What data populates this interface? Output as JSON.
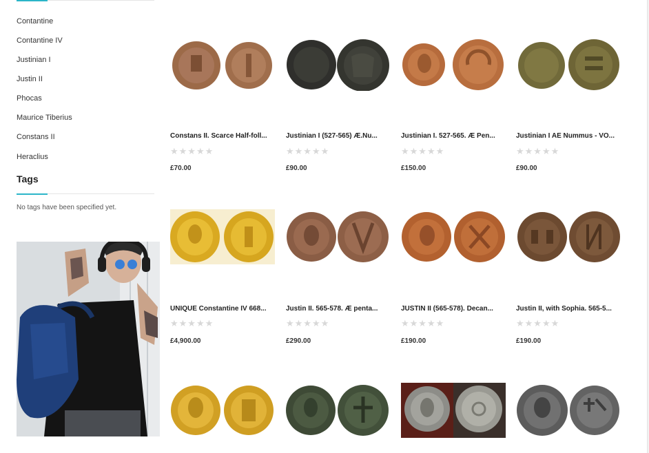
{
  "sidebar": {
    "categories": [
      "Contantine",
      "Contantine IV",
      "Justinian I",
      "Justin II",
      "Phocas",
      "Maurice Tiberius",
      "Constans II",
      "Heraclius"
    ],
    "tags_title": "Tags",
    "tags_empty": "No tags have been specified yet."
  },
  "products": [
    {
      "name": "Constans II. Scarce Half-foll...",
      "price": "£70.00",
      "rating_stars": "★★★★★",
      "rating": 0
    },
    {
      "name": "Justinian I (527-565) Æ.Nu...",
      "price": "£90.00",
      "rating_stars": "★★★★★",
      "rating": 0
    },
    {
      "name": "Justinian I. 527-565. Æ Pen...",
      "price": "£150.00",
      "rating_stars": "★★★★★",
      "rating": 0
    },
    {
      "name": "Justinian I AE Nummus - VO...",
      "price": "£90.00",
      "rating_stars": "★★★★★",
      "rating": 0
    },
    {
      "name": "UNIQUE Constantine IV 668...",
      "price": "£4,900.00",
      "rating_stars": "★★★★★",
      "rating": 0
    },
    {
      "name": "Justin II. 565-578. Æ penta...",
      "price": "£290.00",
      "rating_stars": "★★★★★",
      "rating": 0
    },
    {
      "name": "JUSTIN II (565-578). Decan...",
      "price": "£190.00",
      "rating_stars": "★★★★★",
      "rating": 0
    },
    {
      "name": "Justin II, with Sophia. 565-5...",
      "price": "£190.00",
      "rating_stars": "★★★★★",
      "rating": 0
    },
    {
      "name": "",
      "price": "",
      "rating_stars": "",
      "rating": 0
    },
    {
      "name": "",
      "price": "",
      "rating_stars": "",
      "rating": 0
    },
    {
      "name": "",
      "price": "",
      "rating_stars": "",
      "rating": 0
    },
    {
      "name": "",
      "price": "",
      "rating_stars": "",
      "rating": 0
    }
  ],
  "colors": {
    "accent": "#2bb5c8",
    "star_empty": "#d8d8d8"
  }
}
